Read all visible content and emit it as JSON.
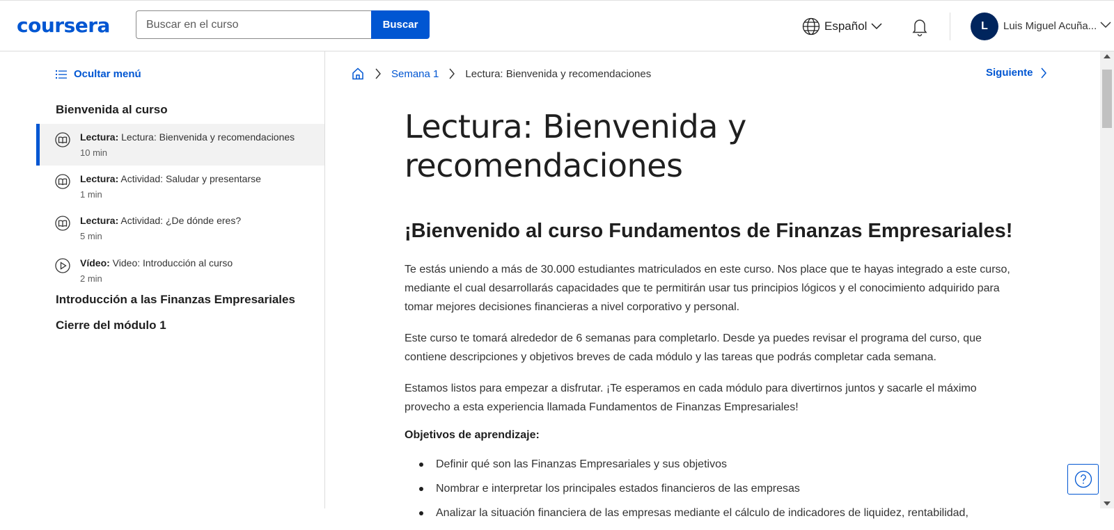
{
  "header": {
    "logo": "coursera",
    "search_placeholder": "Buscar en el curso",
    "search_button": "Buscar",
    "language": "Español",
    "user_initial": "L",
    "user_name": "Luis Miguel Acuña..."
  },
  "sidebar": {
    "hide_menu": "Ocultar menú",
    "sections": [
      {
        "title": "Bienvenida al curso"
      },
      {
        "title": "Introducción a las Finanzas Empresariales"
      },
      {
        "title": "Cierre del módulo 1"
      }
    ],
    "items": [
      {
        "type": "Lectura:",
        "label": "Lectura: Bienvenida y recomendaciones",
        "duration": "10 min",
        "icon": "book-icon",
        "active": true
      },
      {
        "type": "Lectura:",
        "label": "Actividad: Saludar y presentarse",
        "duration": "1 min",
        "icon": "book-icon",
        "active": false
      },
      {
        "type": "Lectura:",
        "label": "Actividad: ¿De dónde eres?",
        "duration": "5 min",
        "icon": "book-icon",
        "active": false
      },
      {
        "type": "Vídeo:",
        "label": "Video: Introducción al curso",
        "duration": "2 min",
        "icon": "play-icon",
        "active": false
      }
    ]
  },
  "breadcrumb": {
    "week": "Semana 1",
    "current": "Lectura: Bienvenida y recomendaciones"
  },
  "next_label": "Siguiente",
  "content": {
    "title": "Lectura: Bienvenida y recomendaciones",
    "welcome_heading": "¡Bienvenido al curso Fundamentos de Finanzas Empresariales!",
    "paragraphs": [
      "Te estás uniendo a más de 30.000 estudiantes matriculados en este curso. Nos place que te hayas integrado a este curso, mediante el cual desarrollarás capacidades que te permitirán usar tus principios lógicos y el conocimiento adquirido para tomar mejores decisiones financieras a nivel corporativo y personal.",
      "Este curso te tomará alrededor de 6 semanas para completarlo. Desde ya puedes revisar el programa del curso, que contiene descripciones y objetivos breves de cada módulo y las tareas que podrás completar cada semana.",
      "Estamos listos para empezar a disfrutar. ¡Te esperamos en cada módulo para divertirnos juntos y sacarle el máximo provecho a esta experiencia llamada Fundamentos de Finanzas Empresariales!"
    ],
    "objectives_title": "Objetivos de aprendizaje:",
    "objectives": [
      "Definir qué son las Finanzas Empresariales y sus objetivos",
      "Nombrar e interpretar los principales estados financieros de las empresas",
      "Analizar la situación financiera de las empresas mediante el cálculo de indicadores de liquidez, rentabilidad,"
    ]
  },
  "colors": {
    "brand": "#0056d2",
    "avatar": "#00255d",
    "active_bg": "#f2f2f2"
  }
}
